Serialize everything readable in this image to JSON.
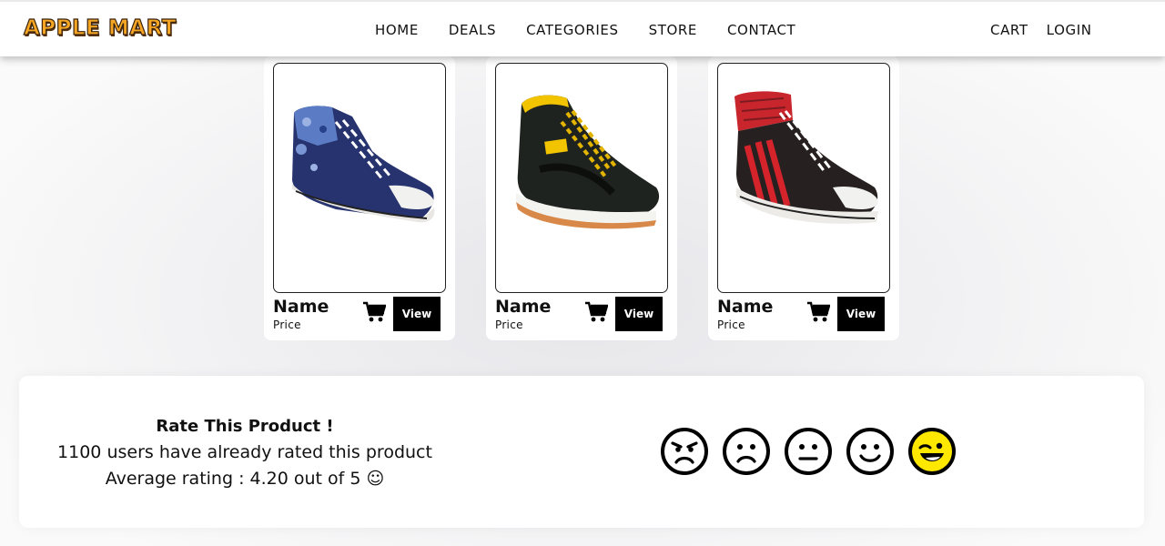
{
  "header": {
    "logo": "APPLE MART",
    "nav": [
      "HOME",
      "DEALS",
      "CATEGORIES",
      "STORE",
      "CONTACT"
    ],
    "cart": "CART",
    "login": "LOGIN"
  },
  "products": [
    {
      "name": "Name",
      "price": "Price",
      "view": "View",
      "shoe": "blue-camo-hightop"
    },
    {
      "name": "Name",
      "price": "Price",
      "view": "View",
      "shoe": "black-yellow-hightop"
    },
    {
      "name": "Name",
      "price": "Price",
      "view": "View",
      "shoe": "black-red-stripe-hightop"
    }
  ],
  "rating": {
    "title": "Rate This Product !",
    "users_line": "1100 users have already rated this product",
    "average_line": "Average rating : 4.20 out of 5 ☺",
    "emojis": [
      "angry",
      "sad",
      "neutral",
      "smile",
      "wink"
    ],
    "selected": "wink",
    "selected_color": "#ffe800"
  }
}
